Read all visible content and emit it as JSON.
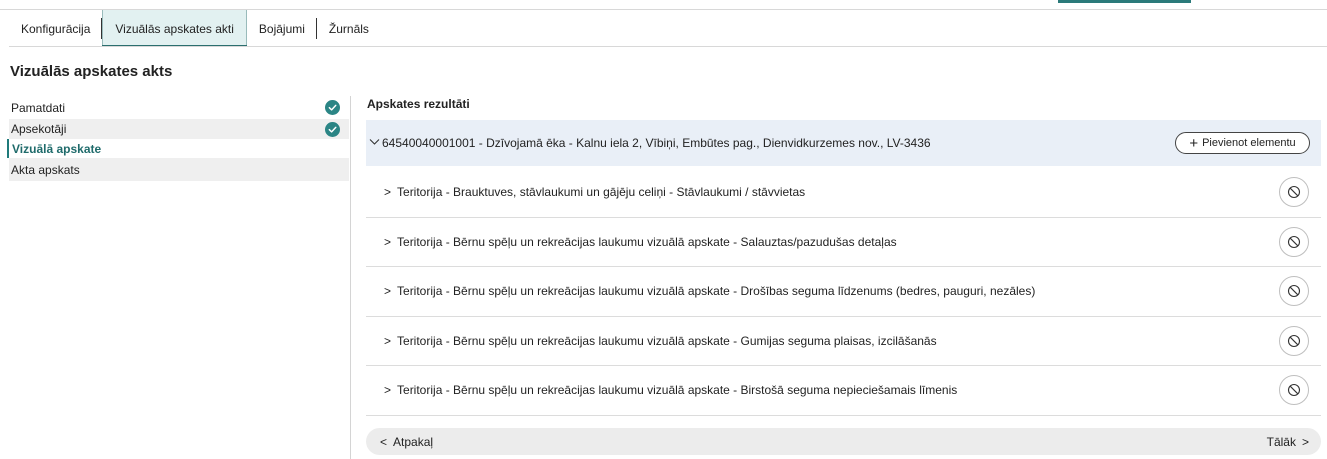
{
  "tabs": [
    {
      "label": "Konfigurācija"
    },
    {
      "label": "Vizuālās apskates akti"
    },
    {
      "label": "Bojājumi"
    },
    {
      "label": "Žurnāls"
    }
  ],
  "page_title": "Vizuālās apskates akts",
  "sidebar": {
    "items": [
      {
        "label": "Pamatdati",
        "status": "completed"
      },
      {
        "label": "Apsekotāji",
        "status": "completed"
      },
      {
        "label": "Vizuālā apskate",
        "status": "current"
      },
      {
        "label": "Akta apskats",
        "status": "none"
      }
    ]
  },
  "results": {
    "title": "Apskates rezultāti",
    "group_label": "64540040001001 - Dzīvojamā ēka - Kalnu iela 2, Vībiņi, Embūtes pag., Dienvidkurzemes nov., LV-3436",
    "add_button_label": "Pievienot elementu",
    "rows": [
      {
        "label": "Teritorija - Brauktuves, stāvlaukumi un gājēju celiņi - Stāvlaukumi / stāvvietas"
      },
      {
        "label": "Teritorija - Bērnu spēļu un rekreācijas laukumu vizuālā apskate - Salauztas/pazudušas detaļas"
      },
      {
        "label": "Teritorija - Bērnu spēļu un rekreācijas laukumu vizuālā apskate - Drošības seguma līdzenums (bedres, pauguri, nezāles)"
      },
      {
        "label": "Teritorija - Bērnu spēļu un rekreācijas laukumu vizuālā apskate - Gumijas seguma plaisas, izcilāšanās"
      },
      {
        "label": "Teritorija - Bērnu spēļu un rekreācijas laukumu vizuālā apskate - Birstošā seguma nepieciešamais līmenis"
      }
    ]
  },
  "footer": {
    "back_label": "Atpakaļ",
    "next_label": "Tālāk"
  },
  "colors": {
    "accent": "#2b7a7a",
    "check_bg": "#2b8585",
    "group_bg": "#e9eff7",
    "active_tab_bg": "#e2f1f1"
  },
  "icons": {
    "check": "check-icon",
    "ban": "ban-icon",
    "plus": "plus-icon",
    "chevron_down": "chevron-down-icon",
    "chevron_right": "chevron-right-icon",
    "chevron_left": "chevron-left-icon"
  }
}
